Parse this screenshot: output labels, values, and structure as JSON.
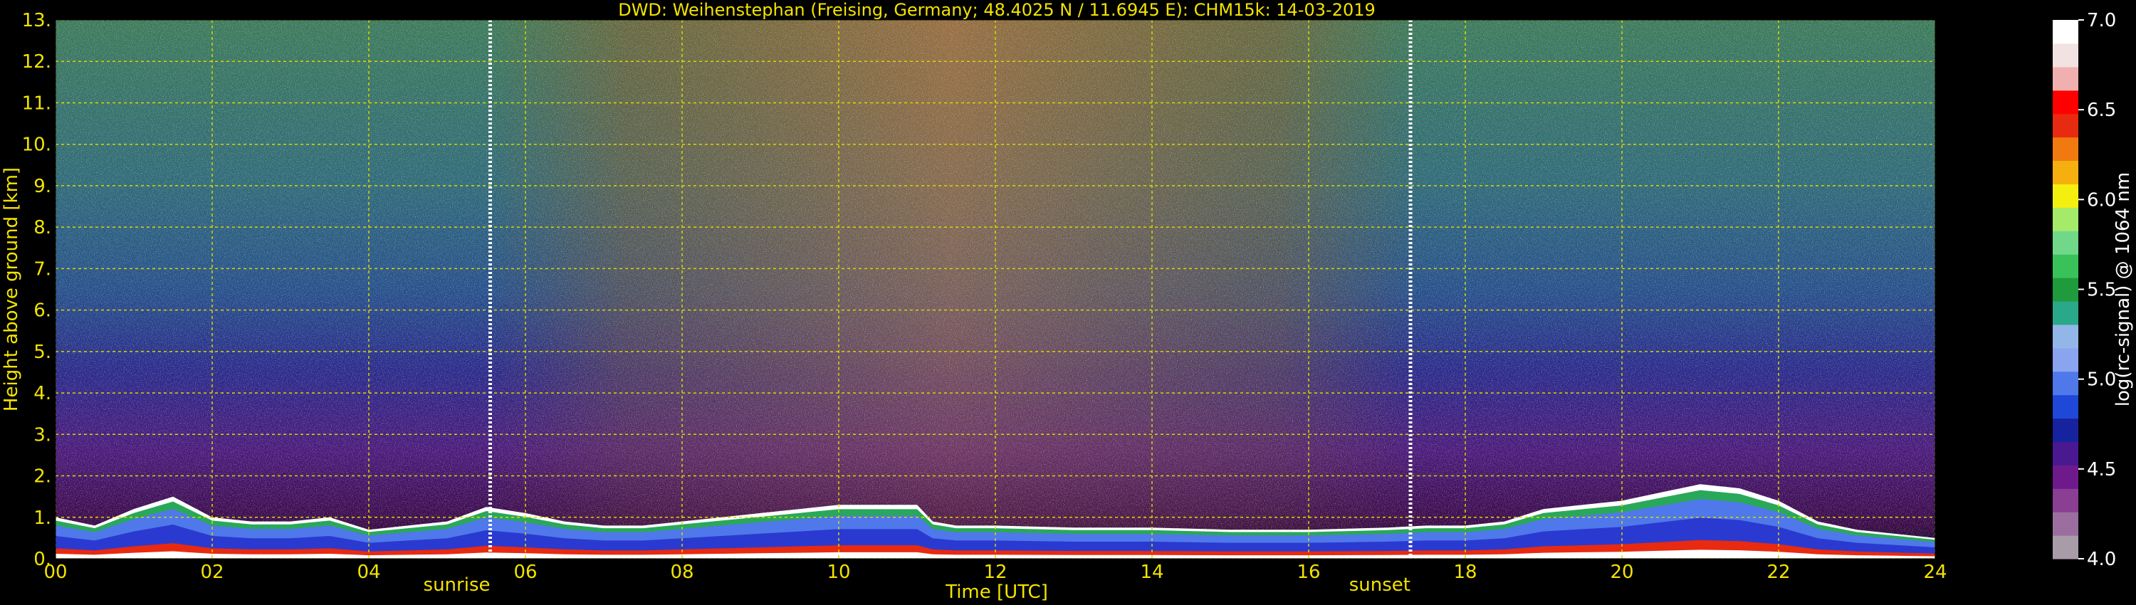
{
  "chart_data": {
    "type": "heatmap",
    "title": "DWD: Weihenstephan (Freising, Germany; 48.4025 N / 11.6945 E):    CHM15k: 14-03-2019",
    "xlabel": "Time [UTC]",
    "ylabel": "Height above ground [km]",
    "xlim": [
      0,
      24
    ],
    "ylim": [
      0,
      13
    ],
    "x_ticks": [
      "00",
      "02",
      "04",
      "06",
      "08",
      "10",
      "12",
      "14",
      "16",
      "18",
      "20",
      "22",
      "24"
    ],
    "y_ticks": [
      "0.",
      "1.",
      "2.",
      "3.",
      "4.",
      "5.",
      "6.",
      "7.",
      "8.",
      "9.",
      "10.",
      "11.",
      "12.",
      "13."
    ],
    "grid": true,
    "colorbar": {
      "label": "log(rc-signal) @ 1064 nm",
      "range": [
        4.0,
        7.0
      ],
      "ticks": [
        "4.0",
        "4.5",
        "5.0",
        "5.5",
        "6.0",
        "6.5",
        "7.0"
      ],
      "colors": [
        "#a89ca8",
        "#9a6fa0",
        "#8a3f93",
        "#6e1a8c",
        "#4a1890",
        "#16229e",
        "#1f48d8",
        "#4f78ea",
        "#8aa4f0",
        "#93b6e8",
        "#2aa88a",
        "#1f9a3c",
        "#39c25a",
        "#71d88a",
        "#a6ea6a",
        "#f5ef10",
        "#f5b010",
        "#f07a10",
        "#e82a10",
        "#ff0000",
        "#f0b0b0",
        "#f2e2e2",
        "#ffffff"
      ]
    },
    "annotations": [
      {
        "text": "sunrise",
        "x": 5.55
      },
      {
        "text": "sunset",
        "x": 17.3
      }
    ],
    "series": [
      {
        "name": "",
        "x": [
          0,
          0.5,
          1,
          1.5,
          2,
          2.5,
          3,
          3.5,
          4,
          4.5,
          5,
          5.5,
          6,
          6.5,
          7,
          7.5,
          8,
          8.5,
          9,
          9.5,
          10,
          10.5,
          11,
          11.2,
          11.5,
          12,
          13,
          14,
          15,
          16,
          17,
          17.5,
          18,
          18.5,
          19,
          19.5,
          20,
          20.5,
          21,
          21.5,
          22,
          22.5,
          23,
          23.5,
          24
        ],
        "y": [
          1.0,
          0.8,
          1.2,
          1.5,
          1.0,
          0.9,
          0.9,
          1.0,
          0.7,
          0.8,
          0.9,
          1.25,
          1.1,
          0.9,
          0.8,
          0.8,
          0.9,
          1.0,
          1.1,
          1.2,
          1.3,
          1.3,
          1.3,
          0.9,
          0.8,
          0.8,
          0.75,
          0.75,
          0.7,
          0.7,
          0.75,
          0.8,
          0.8,
          0.9,
          1.2,
          1.3,
          1.4,
          1.6,
          1.8,
          1.7,
          1.4,
          0.9,
          0.7,
          0.6,
          0.5
        ]
      }
    ]
  }
}
